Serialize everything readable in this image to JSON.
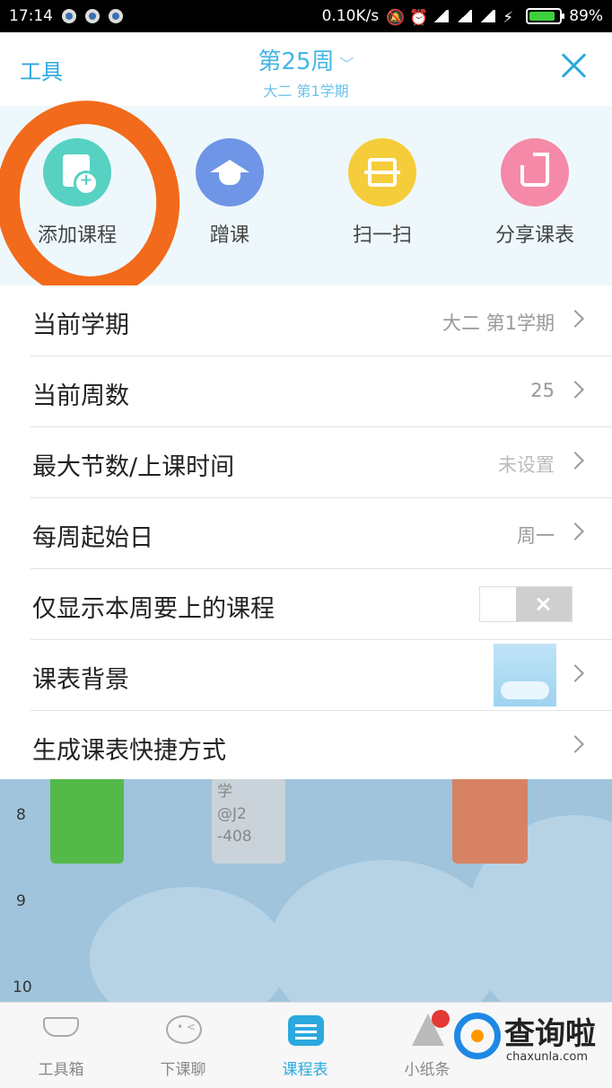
{
  "status_bar": {
    "time": "17:14",
    "network_speed": "0.10K/s",
    "battery_percent": "89%",
    "battery_level": 0.89
  },
  "header": {
    "left_label": "工具",
    "week_title": "第25周",
    "term_subtitle": "大二  第1学期"
  },
  "tools": [
    {
      "label": "添加课程",
      "icon": "add-course-icon",
      "color": "#57d1c2"
    },
    {
      "label": "蹭课",
      "icon": "graduation-cap-icon",
      "color": "#6f95e6"
    },
    {
      "label": "扫一扫",
      "icon": "scan-icon",
      "color": "#f5cd3a"
    },
    {
      "label": "分享课表",
      "icon": "share-icon",
      "color": "#f48aa7"
    }
  ],
  "settings": {
    "current_term": {
      "label": "当前学期",
      "value": "大二  第1学期"
    },
    "current_week": {
      "label": "当前周数",
      "value": "25"
    },
    "max_sections": {
      "label": "最大节数/上课时间",
      "value": "未设置"
    },
    "week_start": {
      "label": "每周起始日",
      "value": "周一"
    },
    "show_this_week_only": {
      "label": "仅显示本周要上的课程",
      "enabled": false
    },
    "background": {
      "label": "课表背景"
    },
    "shortcut": {
      "label": "生成课表快捷方式"
    }
  },
  "timetable": {
    "hours": [
      "8",
      "9",
      "10"
    ],
    "grey_card_lines": [
      "学",
      "@J2",
      "-408"
    ]
  },
  "bottom_nav": [
    {
      "label": "工具箱",
      "icon": "toolbox-icon",
      "active": false
    },
    {
      "label": "下课聊",
      "icon": "chat-icon",
      "active": false
    },
    {
      "label": "课程表",
      "icon": "timetable-icon",
      "active": true
    },
    {
      "label": "小纸条",
      "icon": "paper-plane-icon",
      "active": false
    }
  ],
  "watermark": {
    "title": "查询啦",
    "url": "chaxunla.com"
  },
  "colors": {
    "accent": "#2aa9df",
    "highlight_ring": "#f26a1b"
  }
}
